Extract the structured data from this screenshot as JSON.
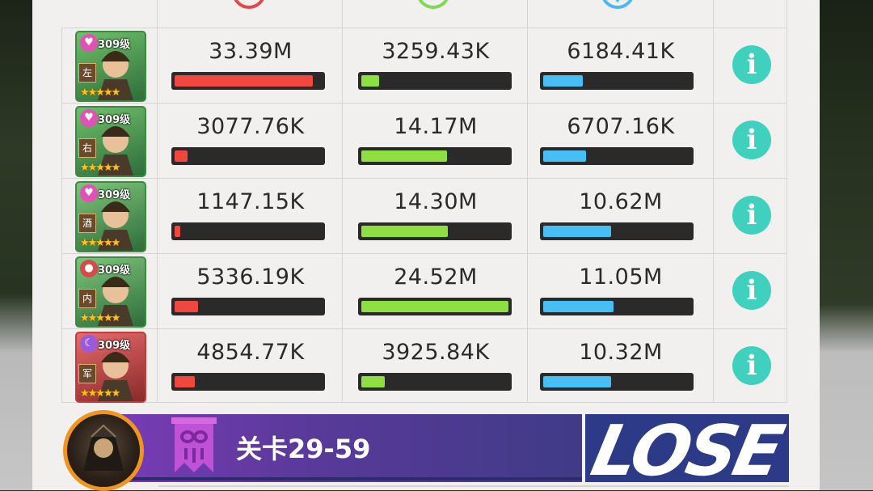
{
  "columns": [
    {
      "icon": "damage-icon",
      "color": "#e04a4a"
    },
    {
      "icon": "heal-icon",
      "color": "#7ed957"
    },
    {
      "icon": "shield-icon",
      "color": "#4db8f0"
    }
  ],
  "colors": {
    "damage": "#f0473e",
    "heal": "#8ee042",
    "shield": "#47bff5",
    "info": "#3fd1bd",
    "panel": "#f1f0ee"
  },
  "heroes": [
    {
      "level": "309级",
      "tag": "左",
      "stars": "★★★★★",
      "gem": "heart",
      "damage": "33.39M",
      "damage_pct": 0.94,
      "heal": "3259.43K",
      "heal_pct": 0.12,
      "shield": "6184.41K",
      "shield_pct": 0.27
    },
    {
      "level": "309级",
      "tag": "右",
      "stars": "★★★★★",
      "gem": "heart",
      "damage": "3077.76K",
      "damage_pct": 0.09,
      "heal": "14.17M",
      "heal_pct": 0.58,
      "shield": "6707.16K",
      "shield_pct": 0.29
    },
    {
      "level": "309级",
      "tag": "酒",
      "stars": "★★★★★",
      "gem": "heart",
      "damage": "1147.15K",
      "damage_pct": 0.04,
      "heal": "14.30M",
      "heal_pct": 0.59,
      "shield": "10.62M",
      "shield_pct": 0.46
    },
    {
      "level": "309级",
      "tag": "内",
      "stars": "★★★★★",
      "gem": "flame",
      "damage": "5336.19K",
      "damage_pct": 0.16,
      "heal": "24.52M",
      "heal_pct": 1.0,
      "shield": "11.05M",
      "shield_pct": 0.48
    },
    {
      "level": "309级",
      "tag": "军",
      "stars": "★★★★★",
      "gem": "moon",
      "damage": "4854.77K",
      "damage_pct": 0.14,
      "heal": "3925.84K",
      "heal_pct": 0.16,
      "shield": "10.32M",
      "shield_pct": 0.46
    }
  ],
  "stage": {
    "label": "关卡29-59",
    "result": "LOSE"
  }
}
